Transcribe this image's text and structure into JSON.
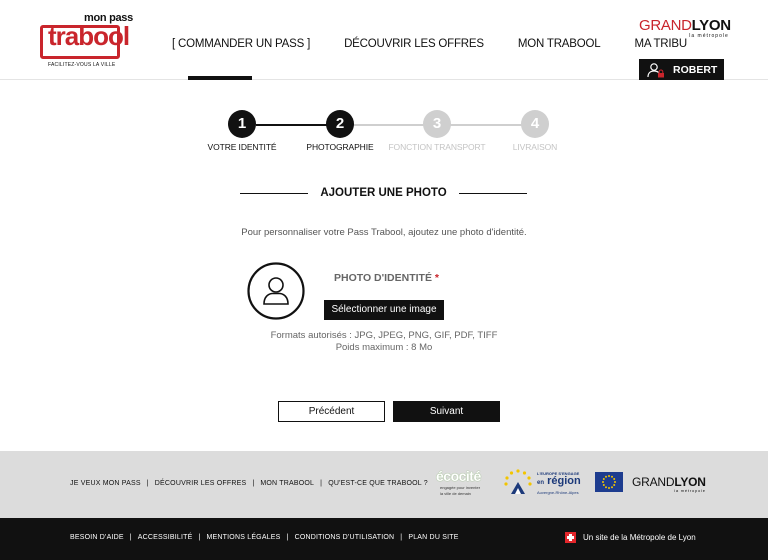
{
  "header": {
    "logo": {
      "top_text": "mon pass",
      "word": "trabool",
      "tagline": "FACILITEZ-VOUS LA VILLE"
    },
    "nav": [
      {
        "label": "[ COMMANDER UN PASS ]",
        "active": true
      },
      {
        "label": "DÉCOUVRIR LES OFFRES",
        "active": false
      },
      {
        "label": "MON TRABOOL",
        "active": false
      },
      {
        "label": "MA TRIBU",
        "active": false
      }
    ],
    "grandlyon": {
      "grand": "GRAND",
      "lyon": "LYON",
      "metro": "la métropole"
    },
    "user": {
      "name": "ROBERT",
      "icon": "user-lock-icon"
    }
  },
  "stepper": {
    "steps": [
      {
        "number": "1",
        "label": "VOTRE IDENTITÉ",
        "state": "active"
      },
      {
        "number": "2",
        "label": "PHOTOGRAPHIE",
        "state": "active"
      },
      {
        "number": "3",
        "label": "FONCTION TRANSPORT",
        "state": "inactive"
      },
      {
        "number": "4",
        "label": "LIVRAISON",
        "state": "inactive"
      }
    ],
    "current": 2
  },
  "main": {
    "title": "AJOUTER UNE PHOTO",
    "intro": "Pour personnaliser votre Pass Trabool, ajoutez une photo d'identité.",
    "photo_label": "PHOTO D'IDENTITÉ",
    "required_mark": "*",
    "select_button": "Sélectionner une image",
    "formats": "Formats autorisés : JPG, JPEG, PNG, GIF, PDF, TIFF",
    "max_size": "Poids maximum : 8 Mo",
    "prev_button": "Précédent",
    "next_button": "Suivant"
  },
  "footer": {
    "links": [
      "JE VEUX MON PASS",
      "DÉCOUVRIR LES OFFRES",
      "MON TRABOOL",
      "QU'EST-CE QUE TRABOOL ?"
    ],
    "ecocite": {
      "logo": "écocité",
      "sub1": "engagée pour inventer",
      "sub2": "la ville de demain"
    },
    "europe": {
      "line1": "L'EUROPE S'ENGAGE",
      "en": "en",
      "region": "région",
      "line3": "Auvergne-Rhône-Alpes"
    },
    "grandlyon": {
      "grand": "GRAND",
      "lyon": "LYON",
      "metro": "la métropole"
    },
    "legal": [
      "BESOIN D'AIDE",
      "ACCESSIBILITÉ",
      "MENTIONS LÉGALES",
      "CONDITIONS D'UTILISATION",
      "PLAN DU SITE"
    ],
    "site_credit": "Un site de la Métropole de Lyon"
  },
  "colors": {
    "brand_red": "#c9252c",
    "black": "#111111",
    "inactive_step": "#cfcfcf",
    "footer_grey": "#dcdcdc"
  }
}
